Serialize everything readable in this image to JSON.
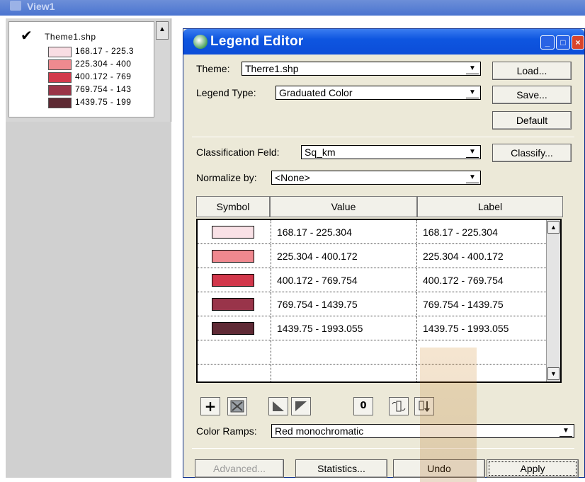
{
  "view": {
    "title": "View1"
  },
  "toc": {
    "theme_name": "Theme1.shp",
    "items": [
      {
        "label": "168.17 - 225.3",
        "color": "#f9dde3"
      },
      {
        "label": "225.304 - 400",
        "color": "#ef8a8f"
      },
      {
        "label": "400.172 - 769",
        "color": "#d23a4c"
      },
      {
        "label": "769.754 - 143",
        "color": "#9a3447"
      },
      {
        "label": "1439.75 - 199",
        "color": "#5e2a33"
      }
    ]
  },
  "dialog": {
    "title": "Legend Editor",
    "theme_label": "Theme:",
    "theme_value": "Therre1.shp",
    "legend_type_label": "Legend Type:",
    "legend_type_value": "Graduated Color",
    "load": "Load...",
    "save": "Save...",
    "default": "Default",
    "classification_label": "Classification Feld:",
    "classification_value": "Sq_km",
    "classify": "Classify...",
    "normalize_label": "Normalize by:",
    "normalize_value": "<None>",
    "columns": {
      "symbol": "Symbol",
      "value": "Value",
      "label": "Label"
    },
    "rows": [
      {
        "color": "#f9e1e6",
        "value": "168.17 - 225.304",
        "label": "168.17 - 225.304"
      },
      {
        "color": "#f0888f",
        "value": "225.304 - 400.172",
        "label": "225.304 - 400.172"
      },
      {
        "color": "#d2374b",
        "value": "400.172 - 769.754",
        "label": "400.172 - 769.754"
      },
      {
        "color": "#99344a",
        "value": "769.754 - 1439.75",
        "label": "769.754 - 1439.75"
      },
      {
        "color": "#5f2a35",
        "value": "1439.75 - 1993.055",
        "label": "1439.75 - 1993.055"
      }
    ],
    "tools": [
      "+",
      "0"
    ],
    "color_ramps_label": "Color Ramps:",
    "color_ramps_value": "Red monochromatic",
    "advanced": "Advanced...",
    "statistics": "Statistics...",
    "undo": "Undo",
    "apply": "Apply"
  }
}
